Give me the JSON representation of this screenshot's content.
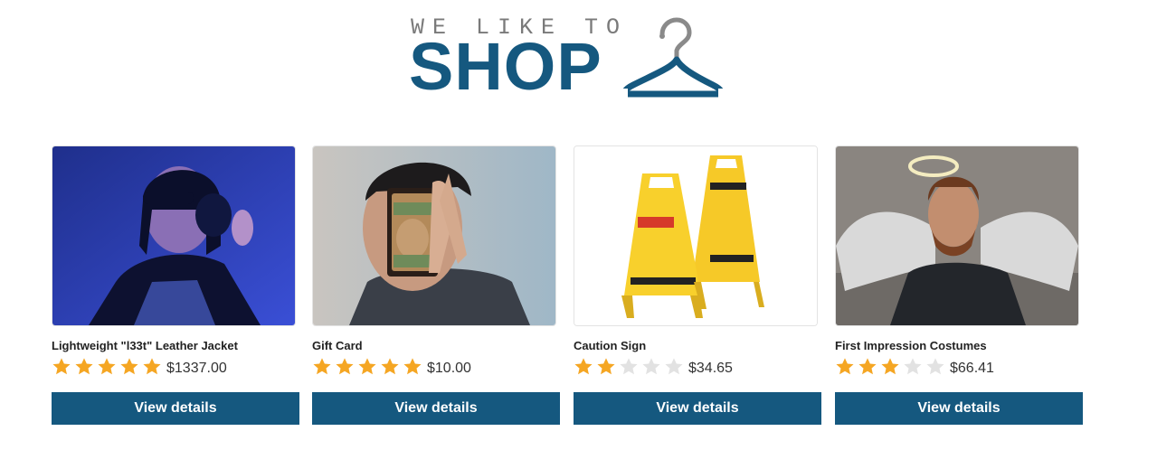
{
  "logo": {
    "tagline": "WE LIKE TO",
    "title": "SHOP",
    "hanger_icon": "clothes-hanger-icon",
    "colors": {
      "tagline": "#7a7a7a",
      "title": "#15587f",
      "hanger": "#15587f"
    }
  },
  "colors": {
    "accent": "#15587f",
    "star_filled": "#f5a623",
    "star_empty": "#e2e2e2"
  },
  "products": [
    {
      "name": "Lightweight \"l33t\" Leather Jacket",
      "rating": 5,
      "rating_max": 5,
      "price": "$1337.00",
      "button_label": "View details"
    },
    {
      "name": "Gift Card",
      "rating": 5,
      "rating_max": 5,
      "price": "$10.00",
      "button_label": "View details"
    },
    {
      "name": "Caution Sign",
      "rating": 2,
      "rating_max": 5,
      "price": "$34.65",
      "button_label": "View details"
    },
    {
      "name": "First Impression Costumes",
      "rating": 3,
      "rating_max": 5,
      "price": "$66.41",
      "button_label": "View details"
    }
  ]
}
